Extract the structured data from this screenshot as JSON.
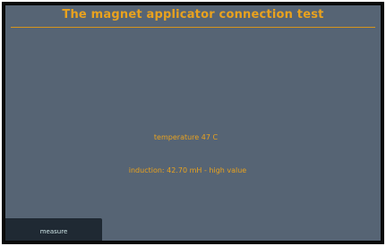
{
  "screen": {
    "title": "The magnet applicator connection test",
    "temperature": "temperature 47 C",
    "induction": "induction: 42.70 mH - high value",
    "measure_label": "measure"
  },
  "colors": {
    "background": "#566474",
    "accent_text": "#e9a21e",
    "button_bg": "#1f2933",
    "button_text": "#cfe6e8"
  }
}
